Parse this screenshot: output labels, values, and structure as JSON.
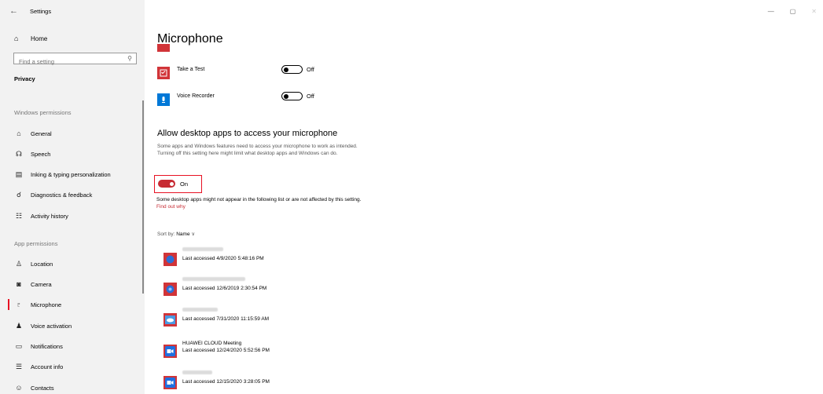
{
  "window": {
    "title": "Settings",
    "back_icon": "←",
    "controls": [
      "—",
      "▢",
      "✕"
    ]
  },
  "sidebar": {
    "home_label": "Home",
    "search_placeholder": "Find a setting",
    "section_title": "Privacy",
    "windows_permissions_label": "Windows permissions",
    "windows_items": [
      {
        "label": "General",
        "icon": "lock-icon"
      },
      {
        "label": "Speech",
        "icon": "speech-icon"
      },
      {
        "label": "Inking & typing personalization",
        "icon": "inking-icon"
      },
      {
        "label": "Diagnostics & feedback",
        "icon": "diagnostics-icon"
      },
      {
        "label": "Activity history",
        "icon": "activity-icon"
      }
    ],
    "app_permissions_label": "App permissions",
    "app_items": [
      {
        "label": "Location",
        "icon": "location-icon"
      },
      {
        "label": "Camera",
        "icon": "camera-icon"
      },
      {
        "label": "Microphone",
        "icon": "microphone-icon",
        "active": true
      },
      {
        "label": "Voice activation",
        "icon": "voice-activation-icon"
      },
      {
        "label": "Notifications",
        "icon": "notifications-icon"
      },
      {
        "label": "Account info",
        "icon": "account-info-icon"
      },
      {
        "label": "Contacts",
        "icon": "contacts-icon"
      }
    ],
    "accent_color": "#e81123"
  },
  "main": {
    "title": "Microphone",
    "store_apps": [
      {
        "name": "Take a Test",
        "toggle_label": "Off",
        "icon_color": "#d13438"
      },
      {
        "name": "Voice Recorder",
        "toggle_label": "Off",
        "icon_color": "#0078d7"
      }
    ],
    "desktop_section": {
      "heading": "Allow desktop apps to access your microphone",
      "description": "Some apps and Windows features need to access your microphone to work as intended. Turning off this setting here might limit what desktop apps and Windows can do.",
      "toggle_label": "On",
      "note": "Some desktop apps might not appear in the following list or are not affected by this setting.",
      "note_link": "Find out why"
    },
    "sort": {
      "prefix": "Sort by:",
      "value": "Name"
    },
    "desktop_apps": [
      {
        "name": "",
        "last_accessed": "Last accessed 4/9/2020 5:48:16 PM"
      },
      {
        "name": "",
        "last_accessed": "Last accessed 12/6/2019 2:30:54 PM"
      },
      {
        "name": "",
        "last_accessed": "Last accessed 7/31/2020 11:15:59 AM"
      },
      {
        "name": "HUAWEI CLOUD Meeting",
        "last_accessed": "Last accessed 12/24/2020 5:52:56 PM"
      },
      {
        "name": "",
        "last_accessed": "Last accessed 12/15/2020 3:28:05 PM"
      }
    ]
  }
}
